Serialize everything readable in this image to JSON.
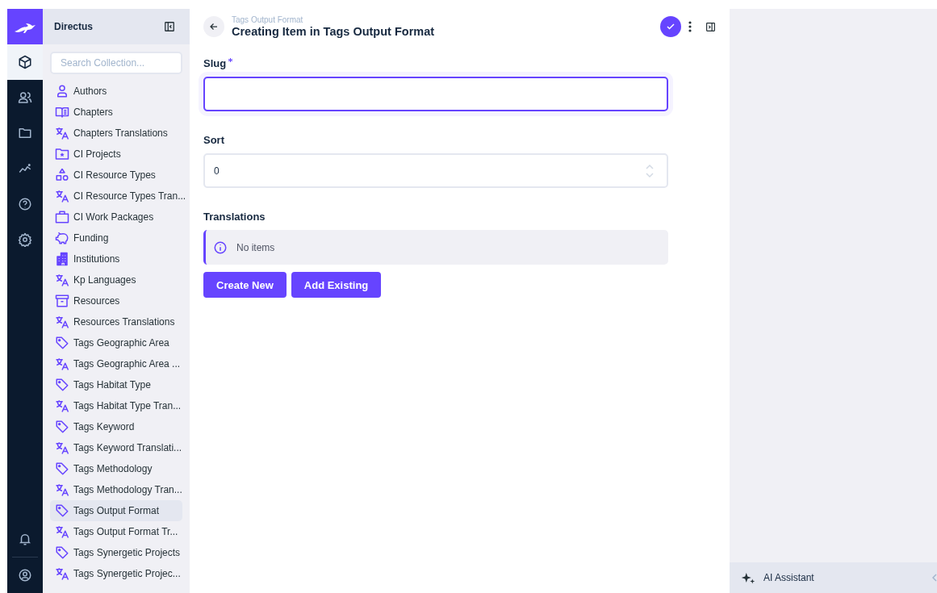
{
  "module_bar": [
    {
      "kind": "content",
      "selected": true
    },
    {
      "kind": "users",
      "selected": false
    },
    {
      "kind": "files",
      "selected": false
    },
    {
      "kind": "insights",
      "selected": false
    },
    {
      "kind": "help",
      "selected": false
    },
    {
      "kind": "settings",
      "selected": false
    }
  ],
  "module_bar_bottom": [
    {
      "kind": "notifications"
    },
    {
      "kind": "account"
    }
  ],
  "navigation": {
    "title": "Directus",
    "search": {
      "placeholder": "Search Collection..."
    },
    "items": [
      {
        "label": "Authors",
        "kind": "person",
        "selected": false
      },
      {
        "label": "Chapters",
        "kind": "book",
        "selected": false
      },
      {
        "label": "Chapters Translations",
        "kind": "translate",
        "selected": false
      },
      {
        "label": "CI Projects",
        "kind": "folder",
        "selected": false
      },
      {
        "label": "CI Resource Types",
        "kind": "shapes",
        "selected": false
      },
      {
        "label": "CI Resource Types Tran...",
        "kind": "translate",
        "selected": false
      },
      {
        "label": "CI Work Packages",
        "kind": "briefcase",
        "selected": false
      },
      {
        "label": "Funding",
        "kind": "piggy",
        "selected": false
      },
      {
        "label": "Institutions",
        "kind": "building",
        "selected": false
      },
      {
        "label": "Kp Languages",
        "kind": "translate",
        "selected": false
      },
      {
        "label": "Resources",
        "kind": "archive",
        "selected": false
      },
      {
        "label": "Resources Translations",
        "kind": "translate",
        "selected": false
      },
      {
        "label": "Tags Geographic Area",
        "kind": "tag",
        "selected": false
      },
      {
        "label": "Tags Geographic Area ...",
        "kind": "translate",
        "selected": false
      },
      {
        "label": "Tags Habitat Type",
        "kind": "tag",
        "selected": false
      },
      {
        "label": "Tags Habitat Type Tran...",
        "kind": "translate",
        "selected": false
      },
      {
        "label": "Tags Keyword",
        "kind": "tag",
        "selected": false
      },
      {
        "label": "Tags Keyword Translati...",
        "kind": "translate",
        "selected": false
      },
      {
        "label": "Tags Methodology",
        "kind": "tag",
        "selected": false
      },
      {
        "label": "Tags Methodology Tran...",
        "kind": "translate",
        "selected": false
      },
      {
        "label": "Tags Output Format",
        "kind": "tag",
        "selected": true
      },
      {
        "label": "Tags Output Format Tr...",
        "kind": "translate",
        "selected": false
      },
      {
        "label": "Tags Synergetic Projects",
        "kind": "tag",
        "selected": false
      },
      {
        "label": "Tags Synergetic Projec...",
        "kind": "translate",
        "selected": false
      }
    ]
  },
  "header": {
    "breadcrumb": "Tags Output Format",
    "title": "Creating Item in Tags Output Format"
  },
  "fields": [
    {
      "label": "Slug",
      "kind": "text",
      "required": true,
      "focused": true
    },
    {
      "label": "Sort",
      "kind": "number",
      "required": false,
      "focused": false,
      "value": "0"
    },
    {
      "label": "Translations",
      "kind": "relation",
      "required": false,
      "notice": "No items",
      "buttons": [
        "Create New",
        "Add Existing"
      ]
    }
  ],
  "sidebar": {
    "ai_assistant": "AI Assistant"
  }
}
